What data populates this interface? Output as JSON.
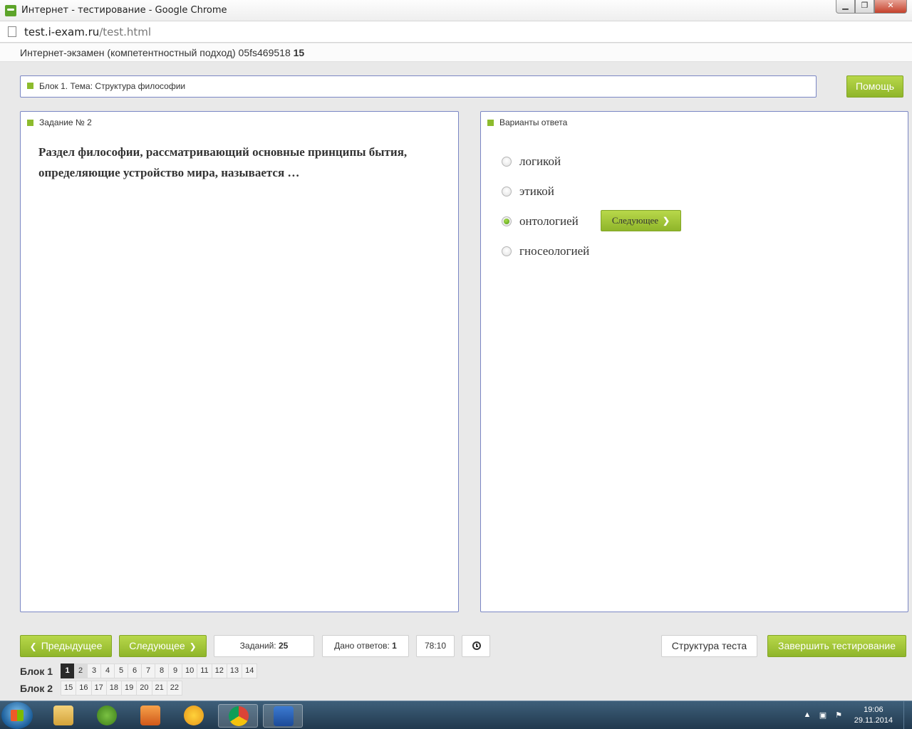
{
  "window": {
    "title": "Интернет - тестирование - Google Chrome",
    "minimize": "▁",
    "maximize": "❐",
    "close": "✕"
  },
  "address": {
    "host": "test.i-exam.ru",
    "path": "/test.html"
  },
  "exam": {
    "title": "Интернет-экзамен (компетентностный подход) 05fs469518",
    "number": "15"
  },
  "topic": {
    "label": "Блок 1. Тема: Структура философии"
  },
  "help_button": "Помощь",
  "task": {
    "caption": "Задание № 2",
    "question": "Раздел философии, рассматривающий основные принципы бытия, определяющие устройство мира, называется …"
  },
  "answers": {
    "caption": "Варианты ответа",
    "options": [
      {
        "label": "логикой",
        "selected": false
      },
      {
        "label": "этикой",
        "selected": false
      },
      {
        "label": "онтологией",
        "selected": true
      },
      {
        "label": "гносеологией",
        "selected": false
      }
    ],
    "next_inline": "Следующее"
  },
  "footer": {
    "prev": "Предыдущее",
    "next": "Следующее",
    "tasks_label": "Заданий:",
    "tasks_count": "25",
    "answered_label": "Дано ответов:",
    "answered_count": "1",
    "timer": "78:10",
    "structure": "Структура теста",
    "finish": "Завершить тестирование"
  },
  "blocks": [
    {
      "label": "Блок 1",
      "items": [
        "1",
        "2",
        "3",
        "4",
        "5",
        "6",
        "7",
        "8",
        "9",
        "10",
        "11",
        "12",
        "13",
        "14"
      ],
      "current": "1",
      "done": [
        "2"
      ]
    },
    {
      "label": "Блок 2",
      "items": [
        "15",
        "16",
        "17",
        "18",
        "19",
        "20",
        "21",
        "22"
      ],
      "current": "",
      "done": []
    }
  ],
  "taskbar": {
    "time": "19:06",
    "date": "29.11.2014",
    "apps": [
      "explorer-icon",
      "utorrent-icon",
      "media-player-icon",
      "mail-agent-icon",
      "chrome-icon",
      "word-icon"
    ]
  },
  "colors": {
    "accent_green": "#8fb52a",
    "panel_border": "#7a86c4",
    "marker": "#8dbb2d"
  }
}
